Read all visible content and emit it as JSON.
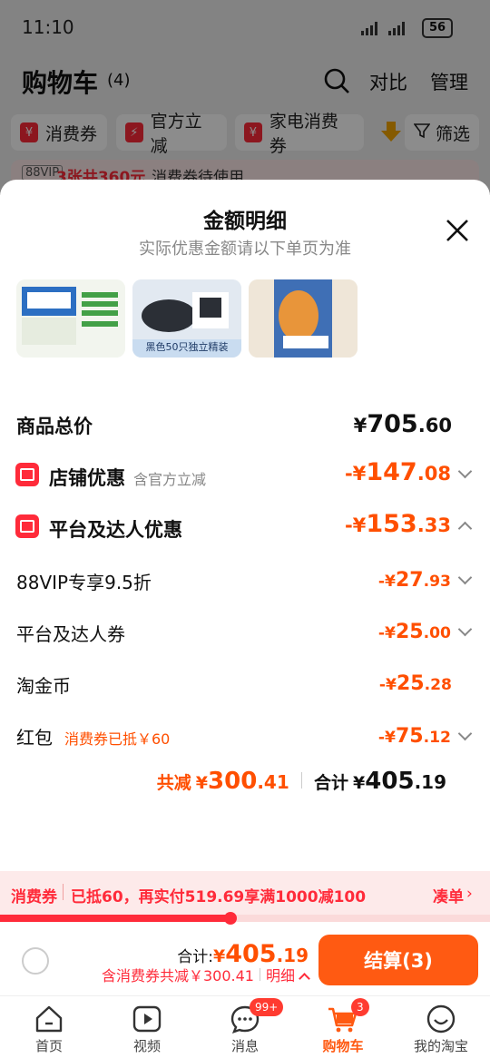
{
  "status_bar": {
    "time": "11:10",
    "battery": "56"
  },
  "header": {
    "title": "购物车",
    "count": "(4)",
    "compare": "对比",
    "manage": "管理"
  },
  "filter_chips": [
    {
      "label": "消费券"
    },
    {
      "label": "官方立减"
    },
    {
      "label": "家电消费券"
    },
    {
      "label": "筛选"
    }
  ],
  "vip_notice": {
    "badge": "88VIP",
    "highlight": "3张共360元",
    "text": "消费券待使用"
  },
  "sheet": {
    "title": "金额明细",
    "subtitle": "实际优惠金额请以下单页为准",
    "thumb_labels": [
      "黑色50只独立精装"
    ],
    "total_price": {
      "label": "商品总价",
      "currency": "¥",
      "int": "705",
      "dec": ".60"
    },
    "store_discount": {
      "label": "店铺优惠",
      "note": "含官方立减",
      "sign": "-¥",
      "int": "147",
      "dec": ".08"
    },
    "platform_discount": {
      "label": "平台及达人优惠",
      "sign": "-¥",
      "int": "153",
      "dec": ".33"
    },
    "vip_discount": {
      "label": "88VIP专享9.5折",
      "sign": "-¥",
      "int": "27",
      "dec": ".93"
    },
    "creator_discount": {
      "label": "平台及达人券",
      "sign": "-¥",
      "int": "25",
      "dec": ".00"
    },
    "coin_discount": {
      "label": "淘金币",
      "sign": "-¥",
      "int": "25",
      "dec": ".28"
    },
    "red_packet": {
      "label": "红包",
      "note": "消费券已抵￥60",
      "sign": "-¥",
      "int": "75",
      "dec": ".12"
    },
    "summary": {
      "saved_label": "共减",
      "saved_currency": "¥",
      "saved_int": "300",
      "saved_dec": ".41",
      "total_label": "合计",
      "total_currency": "¥",
      "total_int": "405",
      "total_dec": ".19"
    }
  },
  "coupon_strip": {
    "tag": "消费券",
    "text": "已抵60，再实付519.69享满1000减100",
    "action": "凑单",
    "progress": 0.47
  },
  "checkout": {
    "total_label": "合计:",
    "currency": "¥",
    "total_int": "405",
    "total_dec": ".19",
    "discount_text": "含消费券共减￥300.41",
    "detail": "明细",
    "button": "结算(3)"
  },
  "nav": [
    {
      "label": "首页",
      "icon": "home-icon"
    },
    {
      "label": "视频",
      "icon": "video-icon"
    },
    {
      "label": "消息",
      "icon": "message-icon",
      "badge": "99+"
    },
    {
      "label": "购物车",
      "icon": "cart-icon",
      "badge": "3",
      "active": true
    },
    {
      "label": "我的淘宝",
      "icon": "profile-icon"
    }
  ],
  "colors": {
    "accent": "#ff4f00",
    "red": "#ff2b3a",
    "button": "#ff5a12"
  }
}
